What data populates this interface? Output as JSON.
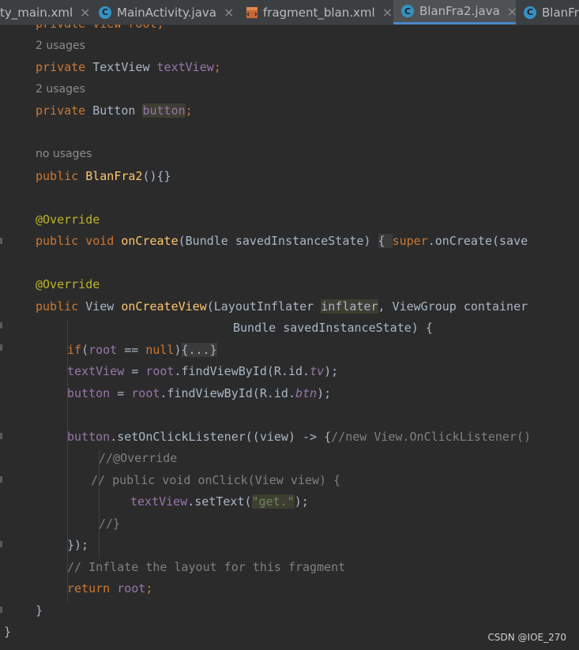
{
  "tabs": [
    {
      "label": "ty_main.xml",
      "icon": "xml-file-icon"
    },
    {
      "label": "MainActivity.java",
      "icon": "java-class-icon"
    },
    {
      "label": "fragment_blan.xml",
      "icon": "xml-layout-icon"
    },
    {
      "label": "BlanFra2.java",
      "icon": "java-class-icon",
      "active": true
    },
    {
      "label": "BlanFr",
      "icon": "java-class-icon"
    }
  ],
  "tab_close_glyph": "×",
  "class_icon_letter": "C",
  "code": {
    "l0": "private View root;",
    "hint1": "2 usages",
    "l1a": "private ",
    "l1b": "TextView ",
    "l1c": "textView",
    "l1d": ";",
    "hint2": "2 usages",
    "l2a": "private ",
    "l2b": "Button ",
    "l2c": "button",
    "l2d": ";",
    "hint3": "no usages",
    "l3a": "public ",
    "l3b": "BlanFra2",
    "l3c": "(){}",
    "ann1": "@Override",
    "l4a": "public void ",
    "l4b": "onCreate",
    "l4c": "(Bundle savedInstanceState) ",
    "l4d": "{",
    "l4e": " ",
    "l4f": "super",
    "l4g": ".onCreate(save",
    "ann2": "@Override",
    "l5a": "public ",
    "l5b": "View ",
    "l5c": "onCreateView",
    "l5d": "(LayoutInflater ",
    "l5e": "inflater",
    "l5f": ", ViewGroup container",
    "l6": "Bundle savedInstanceState) {",
    "l7a": "if",
    "l7b": "(",
    "l7c": "root",
    "l7d": " == ",
    "l7e": "null",
    "l7f": ")",
    "l7g": "{...}",
    "l8a": "textView",
    "l8b": " = ",
    "l8c": "root",
    "l8d": ".findViewById(R.id.",
    "l8e": "tv",
    "l8f": ");",
    "l9a": "button",
    "l9b": " = ",
    "l9c": "root",
    "l9d": ".findViewById(R.id.",
    "l9e": "btn",
    "l9f": ");",
    "l10a": "button",
    "l10b": ".setOnClickListener((view) -> {",
    "l10c": "//new View.OnClickListener()",
    "l11": "//@Override",
    "l12": "// public void onClick(View view) {",
    "l13a": "textView",
    "l13b": ".setText(",
    "l13c": "\"get.\"",
    "l13d": ");",
    "l14": "//}",
    "l15": "});",
    "l16": "// Inflate the layout for this fragment",
    "l17a": "return ",
    "l17b": "root",
    "l17c": ";",
    "l18": "}",
    "l19": "}"
  },
  "watermark": "CSDN @IOE_270",
  "colors": {
    "background": "#2b2b2b",
    "keyword": "#cc7832",
    "field": "#9876aa",
    "method": "#ffc66d",
    "annotation": "#bbb529",
    "string": "#6a8759",
    "comment": "#808080",
    "accent": "#4a88c7"
  }
}
